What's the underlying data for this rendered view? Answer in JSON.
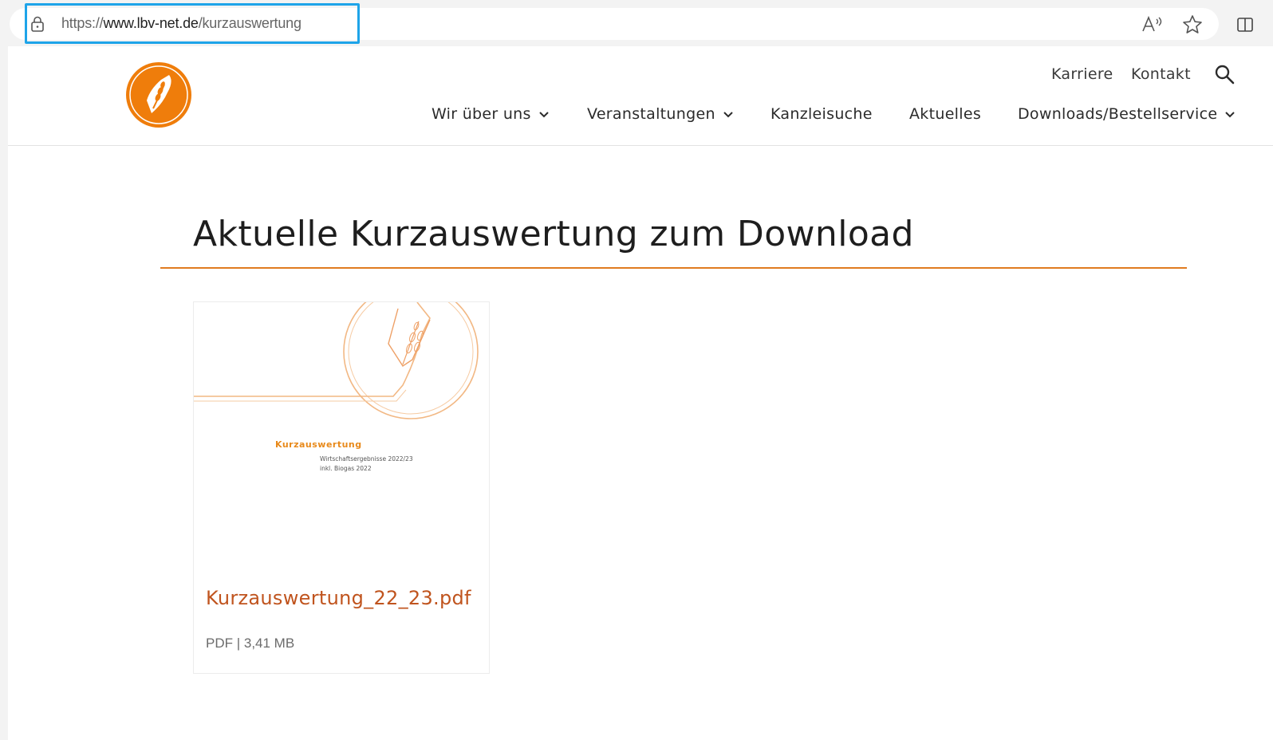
{
  "browser": {
    "url_scheme": "https://",
    "url_host": "www.lbv-net.de",
    "url_path": "/kurzauswertung",
    "icons": [
      "lock-icon",
      "read-aloud-icon",
      "star-icon",
      "split-screen-icon"
    ],
    "highlight_color": "#1ea4e9"
  },
  "header": {
    "logo": "lbv-pen-wheat-logo",
    "top_links": [
      "Karriere",
      "Kontakt"
    ],
    "search_icon": "search-icon",
    "nav": [
      {
        "label": "Wir über uns",
        "has_dropdown": true
      },
      {
        "label": "Veranstaltungen",
        "has_dropdown": true
      },
      {
        "label": "Kanzleisuche",
        "has_dropdown": false
      },
      {
        "label": "Aktuelles",
        "has_dropdown": false
      },
      {
        "label": "Downloads/Bestellservice",
        "has_dropdown": true
      }
    ]
  },
  "main": {
    "title": "Aktuelle Kurzauswertung zum Download",
    "accent_color": "#e07b20",
    "download": {
      "thumbnail": {
        "title": "Kurzauswertung",
        "line1": "Wirtschaftsergebnisse 2022/23",
        "line2": "inkl. Biogas 2022"
      },
      "filename": "Kurzauswertung_22_23.pdf",
      "meta": "PDF | 3,41 MB",
      "link_color": "#c0541e"
    }
  }
}
